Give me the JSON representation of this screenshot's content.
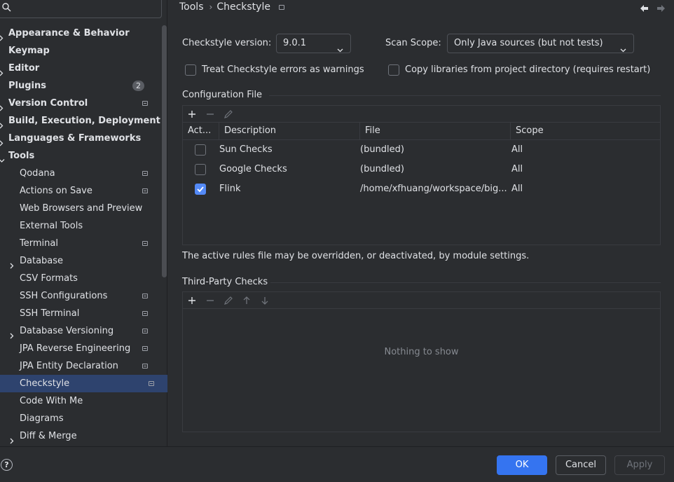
{
  "sidebar": {
    "search": {
      "value": "",
      "placeholder": ""
    },
    "items": [
      {
        "label": "Appearance & Behavior",
        "level": 0,
        "expandable": true,
        "expanded": false
      },
      {
        "label": "Keymap",
        "level": 0
      },
      {
        "label": "Editor",
        "level": 0,
        "expandable": true,
        "expanded": false
      },
      {
        "label": "Plugins",
        "level": 0,
        "badge": "2"
      },
      {
        "label": "Version Control",
        "level": 0,
        "expandable": true,
        "expanded": false,
        "project_icon": true
      },
      {
        "label": "Build, Execution, Deployment",
        "level": 0,
        "expandable": true,
        "expanded": false
      },
      {
        "label": "Languages & Frameworks",
        "level": 0,
        "expandable": true,
        "expanded": false
      },
      {
        "label": "Tools",
        "level": 0,
        "expandable": true,
        "expanded": true
      },
      {
        "label": "Qodana",
        "level": 1,
        "project_icon": true
      },
      {
        "label": "Actions on Save",
        "level": 1,
        "project_icon": true
      },
      {
        "label": "Web Browsers and Preview",
        "level": 1
      },
      {
        "label": "External Tools",
        "level": 1
      },
      {
        "label": "Terminal",
        "level": 1,
        "project_icon": true
      },
      {
        "label": "Database",
        "level": 1,
        "expandable": true,
        "expanded": false
      },
      {
        "label": "CSV Formats",
        "level": 1
      },
      {
        "label": "SSH Configurations",
        "level": 1,
        "project_icon": true
      },
      {
        "label": "SSH Terminal",
        "level": 1,
        "project_icon": true
      },
      {
        "label": "Database Versioning",
        "level": 1,
        "expandable": true,
        "expanded": false,
        "project_icon": true
      },
      {
        "label": "JPA Reverse Engineering",
        "level": 1,
        "project_icon": true
      },
      {
        "label": "JPA Entity Declaration",
        "level": 1,
        "project_icon": true
      },
      {
        "label": "Checkstyle",
        "level": 1,
        "project_icon": true,
        "selected": true
      },
      {
        "label": "Code With Me",
        "level": 1
      },
      {
        "label": "Diagrams",
        "level": 1
      },
      {
        "label": "Diff & Merge",
        "level": 1,
        "expandable": true,
        "expanded": false
      }
    ]
  },
  "breadcrumb": {
    "parent": "Tools",
    "separator": "›",
    "current": "Checkstyle"
  },
  "settings": {
    "version_label": "Checkstyle version:",
    "version_value": "9.0.1",
    "scope_label": "Scan Scope:",
    "scope_value": "Only Java sources (but not tests)",
    "treat_errors_label": "Treat Checkstyle errors as warnings",
    "treat_errors_checked": false,
    "copy_libs_label": "Copy libraries from project directory (requires restart)",
    "copy_libs_checked": false
  },
  "config_file": {
    "title": "Configuration File",
    "columns": [
      "Act...",
      "Description",
      "File",
      "Scope"
    ],
    "rows": [
      {
        "active": false,
        "description": "Sun Checks",
        "file": "(bundled)",
        "scope": "All"
      },
      {
        "active": false,
        "description": "Google Checks",
        "file": "(bundled)",
        "scope": "All"
      },
      {
        "active": true,
        "description": "Flink",
        "file": "/home/xfhuang/workspace/big...",
        "scope": "All"
      }
    ],
    "note": "The active rules file may be overridden, or deactivated, by module settings."
  },
  "third_party": {
    "title": "Third-Party Checks",
    "empty_text": "Nothing to show"
  },
  "footer": {
    "help_label": "?",
    "ok_label": "OK",
    "cancel_label": "Cancel",
    "apply_label": "Apply"
  },
  "colors": {
    "background": "#2b2d30",
    "selection": "#2e436e",
    "primary_button": "#3574f0",
    "checkbox_checked": "#548af7"
  }
}
